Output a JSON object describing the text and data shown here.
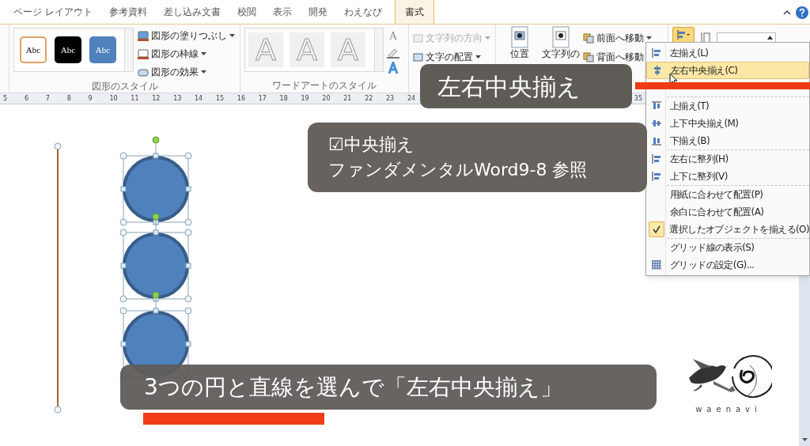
{
  "tabs": [
    {
      "label": "ページ レイアウト",
      "selected": false
    },
    {
      "label": "参考資料",
      "selected": false
    },
    {
      "label": "差し込み文書",
      "selected": false
    },
    {
      "label": "校閲",
      "selected": false
    },
    {
      "label": "表示",
      "selected": false
    },
    {
      "label": "開発",
      "selected": false
    },
    {
      "label": "わえなび",
      "selected": false
    },
    {
      "label": "書式",
      "selected": true
    }
  ],
  "ribbon": {
    "shape_styles": {
      "presets": [
        {
          "label": "Abc",
          "color": "#ffffff"
        },
        {
          "label": "Abc",
          "color": "#000000"
        },
        {
          "label": "Abc",
          "color": "#4f81bd"
        }
      ],
      "commands": [
        "図形の塗りつぶし",
        "図形の枠線",
        "図形の効果"
      ],
      "group_label": "図形のスタイル"
    },
    "wordart_styles": {
      "presets": [
        "A",
        "A",
        "A"
      ],
      "text_fill": "A",
      "group_label": "ワードアートのスタイル"
    },
    "text": {
      "commands": [
        {
          "label": "文字列の方向",
          "disabled": true
        },
        {
          "label": "文字の配置",
          "disabled": false
        }
      ]
    },
    "arrange": {
      "large": [
        "位置",
        "文字列の"
      ],
      "commands": [
        "前面へ移動",
        "背面へ移動"
      ]
    },
    "align_button": {
      "pressed": true
    }
  },
  "ruler": {
    "labels": [
      "5",
      "6",
      "7",
      "8",
      "9",
      "10",
      "11",
      "12",
      "13",
      "14",
      "15",
      "16",
      "17",
      "18",
      "19",
      "20",
      "21",
      "22",
      "23",
      "24"
    ],
    "end_label": "35"
  },
  "menu": {
    "groups": [
      [
        {
          "label": "左揃え(L)",
          "selected": false,
          "checked": false
        },
        {
          "label": "左右中央揃え(C)",
          "selected": true,
          "checked": false
        }
      ],
      [
        {
          "label": "上揃え(T)",
          "selected": false,
          "checked": false
        },
        {
          "label": "上下中央揃え(M)",
          "selected": false,
          "checked": false
        },
        {
          "label": "下揃え(B)",
          "selected": false,
          "checked": false
        }
      ],
      [
        {
          "label": "左右に整列(H)",
          "selected": false,
          "checked": false
        },
        {
          "label": "上下に整列(V)",
          "selected": false,
          "checked": false
        }
      ],
      [
        {
          "label": "用紙に合わせて配置(P)",
          "selected": false,
          "checked": false
        },
        {
          "label": "余白に合わせて配置(A)",
          "selected": false,
          "checked": false
        },
        {
          "label": "選択したオブジェクトを揃える(O)",
          "selected": false,
          "checked": true
        }
      ],
      [
        {
          "label": "グリッド線の表示(S)",
          "selected": false,
          "checked": false
        },
        {
          "label": "グリッドの設定(G)...",
          "selected": false,
          "checked": false
        }
      ]
    ]
  },
  "captions": {
    "title": "左右中央揃え",
    "note_lines": [
      "☑中央揃え",
      "ファンダメンタルWord9-8 参照"
    ],
    "subtitle": "3つの円と直線を選んで「左右中央揃え」"
  },
  "logo": {
    "text": "waenavi"
  }
}
